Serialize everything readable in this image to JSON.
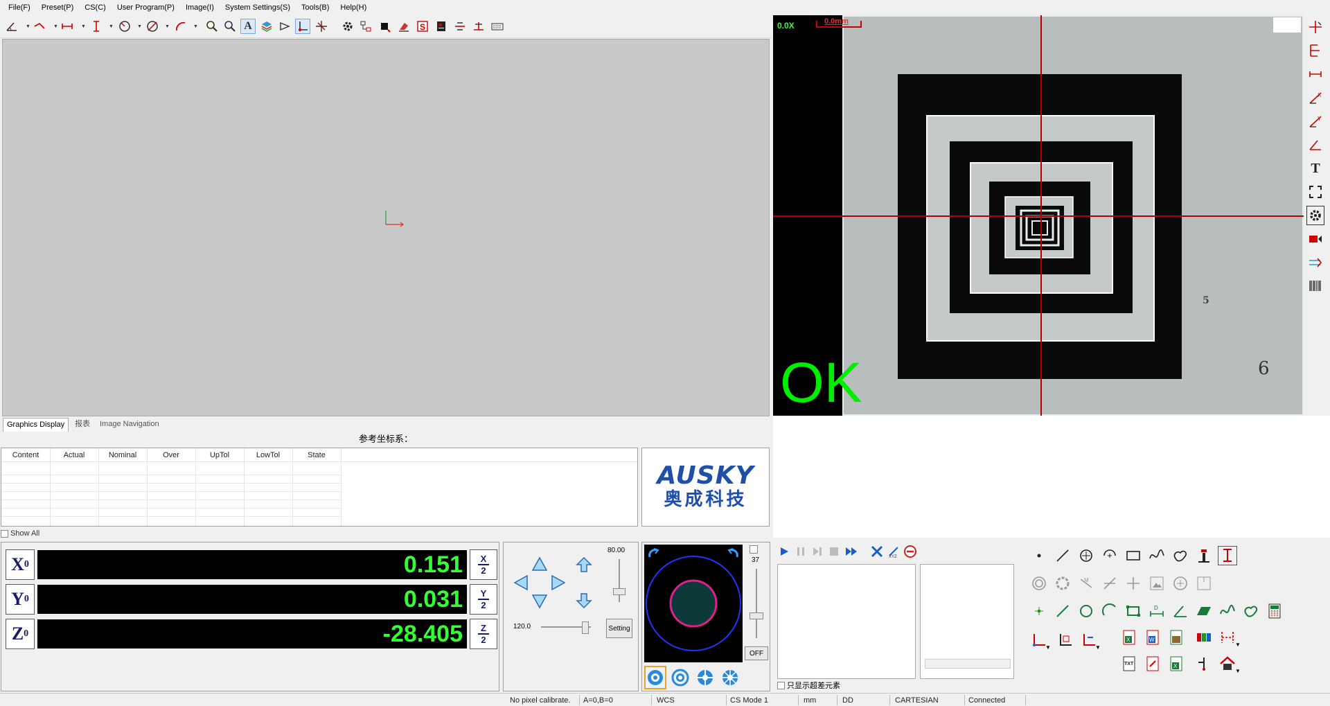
{
  "menu": [
    "File(F)",
    "Preset(P)",
    "CS(C)",
    "User Program(P)",
    "Image(I)",
    "System Settings(S)",
    "Tools(B)",
    "Help(H)"
  ],
  "view_tabs": [
    "Graphics Display",
    "报表",
    "Image Navigation"
  ],
  "camera": {
    "zoom_label": "0.0X",
    "scale_label": "0.0mm",
    "result_text": "OK",
    "target_digit_5": "5",
    "target_digit_6": "6"
  },
  "ref_cs_label": "参考坐标系：",
  "results_table": {
    "columns": [
      "Content",
      "Actual",
      "Nominal",
      "Over",
      "UpTol",
      "LowTol",
      "State"
    ],
    "rows": []
  },
  "logo": {
    "brand": "AUSKY",
    "chinese": "奥成科技"
  },
  "show_all_label": "Show All",
  "dro": {
    "x": {
      "axis": "X",
      "sub": "0",
      "value": "0.151",
      "half_top": "X",
      "half_bottom": "2"
    },
    "y": {
      "axis": "Y",
      "sub": "0",
      "value": "0.031",
      "half_top": "Y",
      "half_bottom": "2"
    },
    "z": {
      "axis": "Z",
      "sub": "0",
      "value": "-28.405",
      "half_top": "Z",
      "half_bottom": "2"
    }
  },
  "jog": {
    "speed_top": "80.00",
    "speed_bottom": "120.0",
    "setting_label": "Setting",
    "speed_top_level": 0.2,
    "speed_bottom_level": 0.95
  },
  "light": {
    "intensity": "37",
    "off_label": "OFF",
    "intensity_level": 0.3
  },
  "program": {
    "only_out_tol_label": "只显示超差元素"
  },
  "status": [
    "No pixel calibrate.",
    "A=0,B=0",
    "WCS",
    "CS Mode 1",
    "mm",
    "DD",
    "CARTESIAN",
    "Connected"
  ],
  "colors": {
    "dro_text": "#33ff33",
    "accent": "#1a1a6a",
    "crosshair": "#c00000",
    "ok_text": "#00ee00"
  }
}
